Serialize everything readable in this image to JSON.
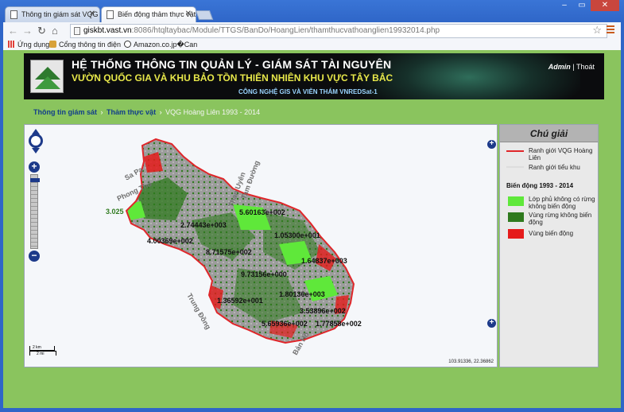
{
  "browser": {
    "tabs": [
      {
        "title": "Thông tin giám sát VQG",
        "active": false
      },
      {
        "title": "Biến động thảm thực vật",
        "active": true
      }
    ],
    "url_host": "giskbt.vast.vn",
    "url_path": ":8086/htqltaybac/Module/TTGS/BanDo/HoangLien/thamthucvathoanglien19932014.php",
    "bookmarks": [
      {
        "label": "Ứng dụng",
        "icon": "apps-grid-icon"
      },
      {
        "label": "Cổng thông tin điện",
        "icon": "portal-icon"
      },
      {
        "label": "Amazon.co.jp�Can",
        "icon": "amazon-icon"
      }
    ]
  },
  "banner": {
    "title": "HỆ THỐNG THÔNG TIN QUẢN LÝ - GIÁM SÁT TÀI NGUYÊN",
    "subtitle": "VƯỜN QUỐC GIA VÀ KHU BẢO TỒN THIÊN NHIÊN KHU VỰC TÂY BẮC",
    "tagline": "CÔNG NGHỆ GIS VÀ VIỄN THÁM VNREDSat-1",
    "user": "Admin",
    "separator": "|",
    "logout": "Thoát"
  },
  "breadcrumb": {
    "items": [
      "Thông tin giám sát",
      "Thảm thực vật"
    ],
    "current": "VQG Hoàng Liên 1993 - 2014",
    "sep": "›"
  },
  "map": {
    "place_labels": [
      "Sa Pa",
      "Phong Thổ",
      "Than Uyên",
      "Tam Đường",
      "Trung Đồng",
      "Bản Hồ"
    ],
    "value_labels": [
      "3.025",
      "2.74443e+003",
      "5.60163e+002",
      "1.05300e+001",
      "4.00369e+002",
      "8.71575e+002",
      "1.64837e+003",
      "9.73156e+000",
      "1.36592e+001",
      "1.80136e+003",
      "3.53896e+002",
      "5.65936e+002",
      "1.77858e+002"
    ],
    "scale_km": "2 km",
    "scale_mi": "2 mi",
    "coords": "103.91336, 22.36862",
    "zoom_level_fraction": 0.04,
    "colors": {
      "boundary": "#e0262a",
      "stable_cover": "#5fe83a",
      "stable_forest": "#2f7a1e",
      "change": "#e51b1b",
      "gray": "#9c9c9c"
    }
  },
  "legend": {
    "title": "Chú giải",
    "items": [
      {
        "label": "Ranh giới VQG Hoàng Liên",
        "color": "#e0262a",
        "kind": "line"
      },
      {
        "label": "Ranh giới tiểu khu",
        "color": "#ffffff",
        "kind": "line"
      }
    ],
    "section": "Biến động 1993 - 2014",
    "classes": [
      {
        "label": "Lớp phủ không có rừng không biến động",
        "color": "#5fe83a"
      },
      {
        "label": "Vùng rừng không biến động",
        "color": "#2f7a1e"
      },
      {
        "label": "Vùng biến động",
        "color": "#e51b1b"
      }
    ]
  }
}
